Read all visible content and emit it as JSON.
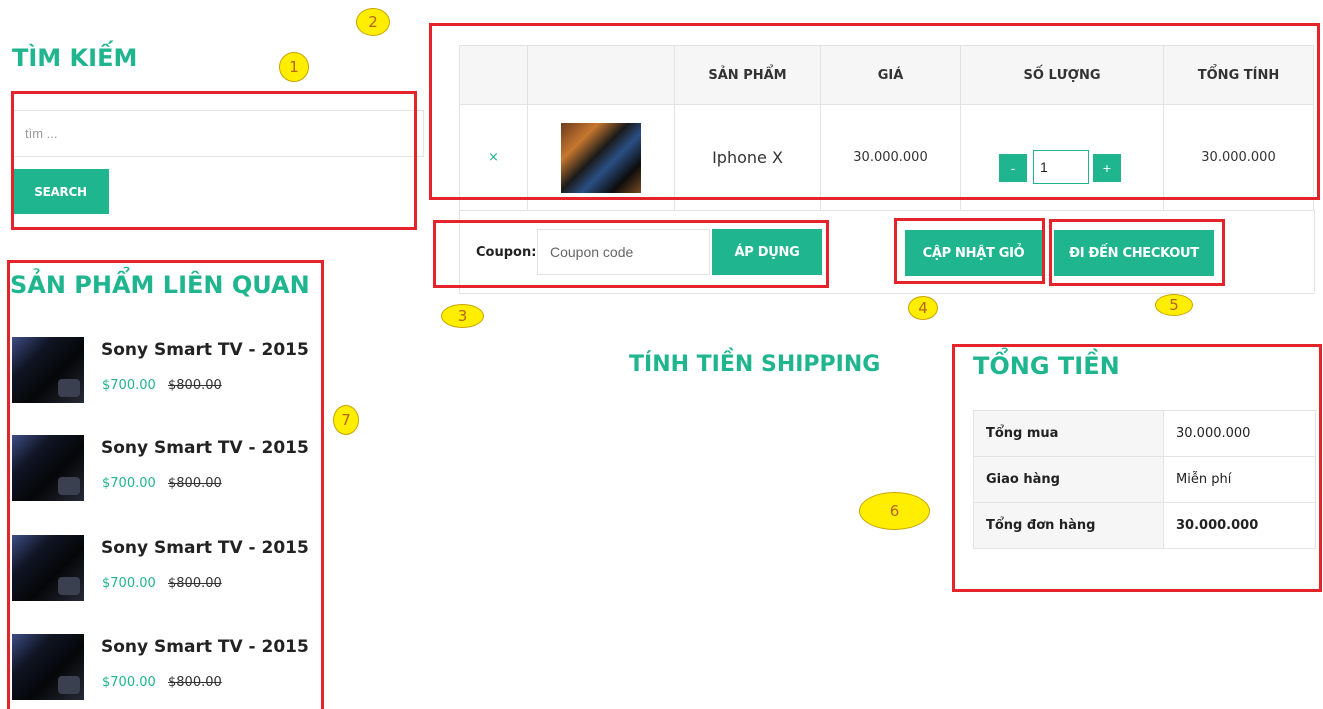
{
  "search": {
    "title": "TÌM KIẾM",
    "placeholder": "tìm ...",
    "button_label": "SEARCH"
  },
  "related": {
    "title": "SẢN PHẨM LIÊN QUAN",
    "items": [
      {
        "name": "Sony Smart TV - 2015",
        "price": "$700.00",
        "old_price": "$800.00"
      },
      {
        "name": "Sony Smart TV - 2015",
        "price": "$700.00",
        "old_price": "$800.00"
      },
      {
        "name": "Sony Smart TV - 2015",
        "price": "$700.00",
        "old_price": "$800.00"
      },
      {
        "name": "Sony Smart TV - 2015",
        "price": "$700.00",
        "old_price": "$800.00"
      }
    ]
  },
  "cart": {
    "headers": [
      "",
      "",
      "SẢN PHẨM",
      "GIÁ",
      "SỐ LƯỢNG",
      "TỔNG TÍNH"
    ],
    "rows": [
      {
        "remove": "×",
        "product": "Iphone X",
        "price": "30.000.000",
        "quantity": "1",
        "subtotal": "30.000.000"
      }
    ],
    "qty_minus": "-",
    "qty_plus": "+"
  },
  "coupon": {
    "label": "Coupon:",
    "placeholder": "Coupon code",
    "apply_label": "ÁP DỤNG"
  },
  "actions": {
    "update_label": "CẬP NHẬT GIỎ",
    "checkout_label": "ĐI ĐẾN CHECKOUT"
  },
  "shipping": {
    "title": "TÍNH TIỀN SHIPPING"
  },
  "totals": {
    "title": "TỔNG TIỀN",
    "rows": [
      {
        "label": "Tổng mua",
        "value": "30.000.000"
      },
      {
        "label": "Giao hàng",
        "value": "Miễn phí"
      },
      {
        "label": "Tổng đơn hàng",
        "value": "30.000.000"
      }
    ]
  },
  "annotations": [
    "1",
    "2",
    "3",
    "4",
    "5",
    "6",
    "7"
  ],
  "colors": {
    "accent": "#1fb58f",
    "annotation_box": "#e5232a",
    "marker": "#ffee00"
  }
}
